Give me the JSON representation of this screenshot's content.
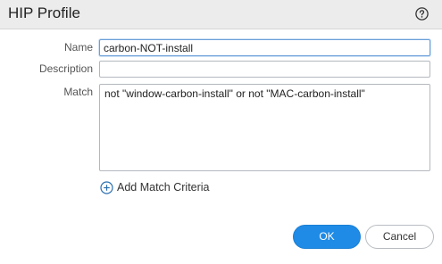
{
  "dialog": {
    "title": "HIP Profile"
  },
  "form": {
    "name_label": "Name",
    "name_value": "carbon-NOT-install",
    "description_label": "Description",
    "description_value": "",
    "match_label": "Match",
    "match_value": "not \"window-carbon-install\" or not \"MAC-carbon-install\""
  },
  "actions": {
    "add_match_label": "Add Match Criteria",
    "ok_label": "OK",
    "cancel_label": "Cancel"
  },
  "colors": {
    "primary_button": "#1f8be6",
    "header_bg": "#ececec",
    "focus_border": "#6a9fd8"
  },
  "icons": {
    "help": "help-icon",
    "add": "add-circle-icon"
  }
}
